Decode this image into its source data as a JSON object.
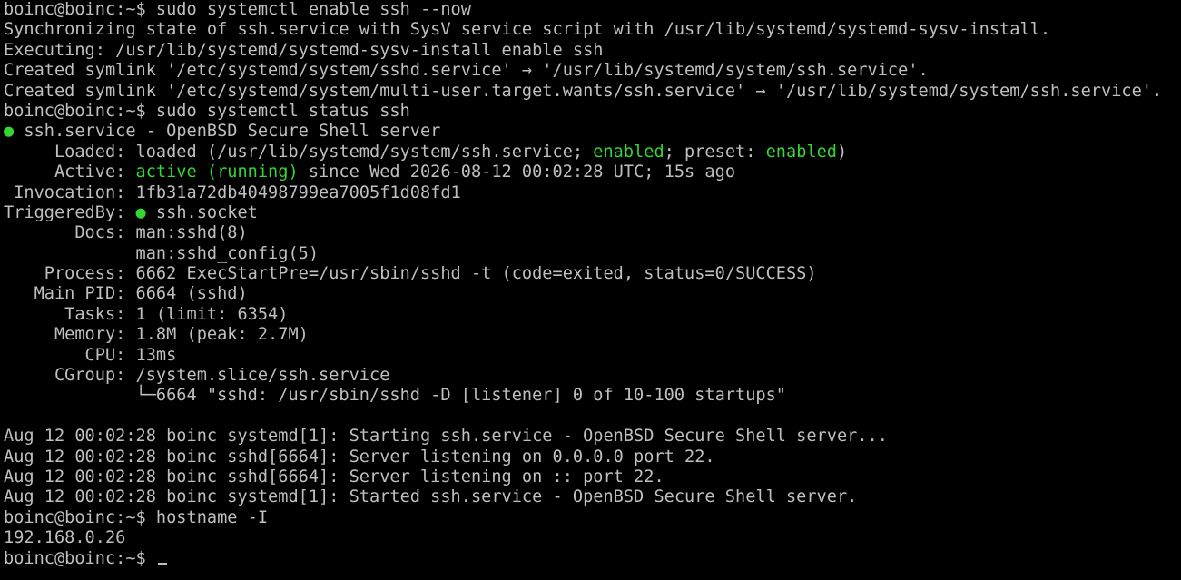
{
  "terminal": {
    "lines": [
      {
        "segments": [
          {
            "text": "boinc@boinc:~$ sudo systemctl enable ssh --now"
          }
        ]
      },
      {
        "segments": [
          {
            "text": "Synchronizing state of ssh.service with SysV service script with /usr/lib/systemd/systemd-sysv-install."
          }
        ]
      },
      {
        "segments": [
          {
            "text": "Executing: /usr/lib/systemd/systemd-sysv-install enable ssh"
          }
        ]
      },
      {
        "segments": [
          {
            "text": "Created symlink '/etc/systemd/system/sshd.service' → '/usr/lib/systemd/system/ssh.service'."
          }
        ]
      },
      {
        "segments": [
          {
            "text": "Created symlink '/etc/systemd/system/multi-user.target.wants/ssh.service' → '/usr/lib/systemd/system/ssh.service'."
          }
        ]
      },
      {
        "segments": [
          {
            "text": "boinc@boinc:~$ sudo systemctl status ssh"
          }
        ]
      },
      {
        "segments": [
          {
            "text": "●",
            "color": "green"
          },
          {
            "text": " ssh.service - OpenBSD Secure Shell server"
          }
        ]
      },
      {
        "segments": [
          {
            "text": "     Loaded: loaded (/usr/lib/systemd/system/ssh.service; "
          },
          {
            "text": "enabled",
            "color": "green"
          },
          {
            "text": "; preset: "
          },
          {
            "text": "enabled",
            "color": "green"
          },
          {
            "text": ")"
          }
        ]
      },
      {
        "segments": [
          {
            "text": "     Active: "
          },
          {
            "text": "active (running)",
            "color": "green"
          },
          {
            "text": " since Wed 2026-08-12 00:02:28 UTC; 15s ago"
          }
        ]
      },
      {
        "segments": [
          {
            "text": " Invocation: 1fb31a72db40498799ea7005f1d08fd1"
          }
        ]
      },
      {
        "segments": [
          {
            "text": "TriggeredBy: "
          },
          {
            "text": "●",
            "color": "green"
          },
          {
            "text": " ssh.socket"
          }
        ]
      },
      {
        "segments": [
          {
            "text": "       Docs: man:sshd(8)"
          }
        ]
      },
      {
        "segments": [
          {
            "text": "             man:sshd_config(5)"
          }
        ]
      },
      {
        "segments": [
          {
            "text": "    Process: 6662 ExecStartPre=/usr/sbin/sshd -t (code=exited, status=0/SUCCESS)"
          }
        ]
      },
      {
        "segments": [
          {
            "text": "   Main PID: 6664 (sshd)"
          }
        ]
      },
      {
        "segments": [
          {
            "text": "      Tasks: 1 (limit: 6354)"
          }
        ]
      },
      {
        "segments": [
          {
            "text": "     Memory: 1.8M (peak: 2.7M)"
          }
        ]
      },
      {
        "segments": [
          {
            "text": "        CPU: 13ms"
          }
        ]
      },
      {
        "segments": [
          {
            "text": "     CGroup: /system.slice/ssh.service"
          }
        ]
      },
      {
        "segments": [
          {
            "text": "             └─6664 \"sshd: /usr/sbin/sshd -D [listener] 0 of 10-100 startups\""
          }
        ]
      },
      {
        "segments": [
          {
            "text": ""
          }
        ]
      },
      {
        "segments": [
          {
            "text": "Aug 12 00:02:28 boinc systemd[1]: Starting ssh.service - OpenBSD Secure Shell server..."
          }
        ]
      },
      {
        "segments": [
          {
            "text": "Aug 12 00:02:28 boinc sshd[6664]: Server listening on 0.0.0.0 port 22."
          }
        ]
      },
      {
        "segments": [
          {
            "text": "Aug 12 00:02:28 boinc sshd[6664]: Server listening on :: port 22."
          }
        ]
      },
      {
        "segments": [
          {
            "text": "Aug 12 00:02:28 boinc systemd[1]: Started ssh.service - OpenBSD Secure Shell server."
          }
        ]
      },
      {
        "segments": [
          {
            "text": "boinc@boinc:~$ hostname -I"
          }
        ]
      },
      {
        "segments": [
          {
            "text": "192.168.0.26"
          }
        ]
      },
      {
        "segments": [
          {
            "text": "boinc@boinc:~$ "
          }
        ],
        "cursor": true
      }
    ]
  },
  "colors": {
    "background": "#000000",
    "foreground": "#bfbfbf",
    "green": "#33d633"
  }
}
